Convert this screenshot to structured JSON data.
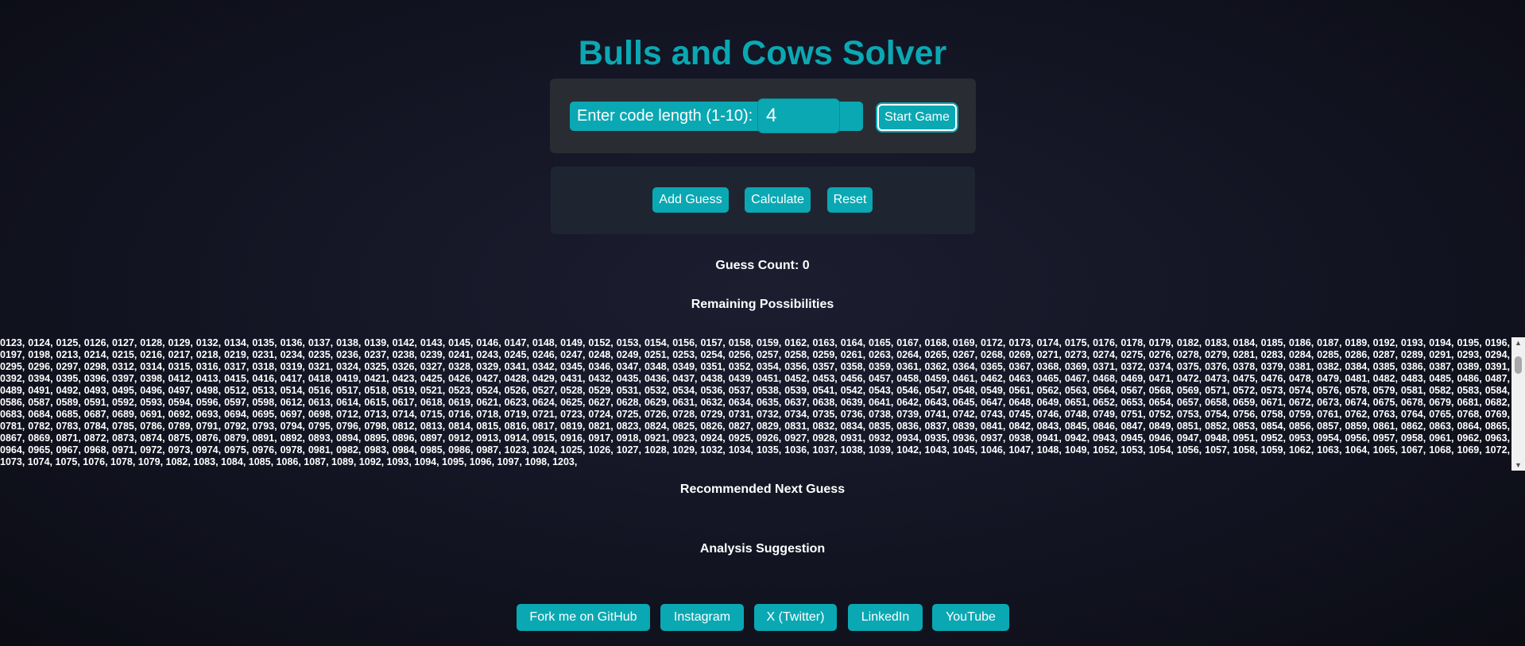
{
  "title": "Bulls and Cows Solver",
  "setup": {
    "length_label": "Enter code length (1-10):",
    "length_value": "4",
    "start_label": "Start Game"
  },
  "actions": {
    "add_guess": "Add Guess",
    "calculate": "Calculate",
    "reset": "Reset"
  },
  "guess_count": "Guess Count: 0",
  "remaining_heading": "Remaining Possibilities",
  "remaining_list": "0123, 0124, 0125, 0126, 0127, 0128, 0129, 0132, 0134, 0135, 0136, 0137, 0138, 0139, 0142, 0143, 0145, 0146, 0147, 0148, 0149, 0152, 0153, 0154, 0156, 0157, 0158, 0159, 0162, 0163, 0164, 0165, 0167, 0168, 0169, 0172, 0173, 0174, 0175, 0176, 0178, 0179, 0182, 0183, 0184, 0185, 0186, 0187, 0189, 0192, 0193, 0194, 0195, 0196, 0197, 0198, 0213, 0214, 0215, 0216, 0217, 0218, 0219, 0231, 0234, 0235, 0236, 0237, 0238, 0239, 0241, 0243, 0245, 0246, 0247, 0248, 0249, 0251, 0253, 0254, 0256, 0257, 0258, 0259, 0261, 0263, 0264, 0265, 0267, 0268, 0269, 0271, 0273, 0274, 0275, 0276, 0278, 0279, 0281, 0283, 0284, 0285, 0286, 0287, 0289, 0291, 0293, 0294, 0295, 0296, 0297, 0298, 0312, 0314, 0315, 0316, 0317, 0318, 0319, 0321, 0324, 0325, 0326, 0327, 0328, 0329, 0341, 0342, 0345, 0346, 0347, 0348, 0349, 0351, 0352, 0354, 0356, 0357, 0358, 0359, 0361, 0362, 0364, 0365, 0367, 0368, 0369, 0371, 0372, 0374, 0375, 0376, 0378, 0379, 0381, 0382, 0384, 0385, 0386, 0387, 0389, 0391, 0392, 0394, 0395, 0396, 0397, 0398, 0412, 0413, 0415, 0416, 0417, 0418, 0419, 0421, 0423, 0425, 0426, 0427, 0428, 0429, 0431, 0432, 0435, 0436, 0437, 0438, 0439, 0451, 0452, 0453, 0456, 0457, 0458, 0459, 0461, 0462, 0463, 0465, 0467, 0468, 0469, 0471, 0472, 0473, 0475, 0476, 0478, 0479, 0481, 0482, 0483, 0485, 0486, 0487, 0489, 0491, 0492, 0493, 0495, 0496, 0497, 0498, 0512, 0513, 0514, 0516, 0517, 0518, 0519, 0521, 0523, 0524, 0526, 0527, 0528, 0529, 0531, 0532, 0534, 0536, 0537, 0538, 0539, 0541, 0542, 0543, 0546, 0547, 0548, 0549, 0561, 0562, 0563, 0564, 0567, 0568, 0569, 0571, 0572, 0573, 0574, 0576, 0578, 0579, 0581, 0582, 0583, 0584, 0586, 0587, 0589, 0591, 0592, 0593, 0594, 0596, 0597, 0598, 0612, 0613, 0614, 0615, 0617, 0618, 0619, 0621, 0623, 0624, 0625, 0627, 0628, 0629, 0631, 0632, 0634, 0635, 0637, 0638, 0639, 0641, 0642, 0643, 0645, 0647, 0648, 0649, 0651, 0652, 0653, 0654, 0657, 0658, 0659, 0671, 0672, 0673, 0674, 0675, 0678, 0679, 0681, 0682, 0683, 0684, 0685, 0687, 0689, 0691, 0692, 0693, 0694, 0695, 0697, 0698, 0712, 0713, 0714, 0715, 0716, 0718, 0719, 0721, 0723, 0724, 0725, 0726, 0728, 0729, 0731, 0732, 0734, 0735, 0736, 0738, 0739, 0741, 0742, 0743, 0745, 0746, 0748, 0749, 0751, 0752, 0753, 0754, 0756, 0758, 0759, 0761, 0762, 0763, 0764, 0765, 0768, 0769, 0781, 0782, 0783, 0784, 0785, 0786, 0789, 0791, 0792, 0793, 0794, 0795, 0796, 0798, 0812, 0813, 0814, 0815, 0816, 0817, 0819, 0821, 0823, 0824, 0825, 0826, 0827, 0829, 0831, 0832, 0834, 0835, 0836, 0837, 0839, 0841, 0842, 0843, 0845, 0846, 0847, 0849, 0851, 0852, 0853, 0854, 0856, 0857, 0859, 0861, 0862, 0863, 0864, 0865, 0867, 0869, 0871, 0872, 0873, 0874, 0875, 0876, 0879, 0891, 0892, 0893, 0894, 0895, 0896, 0897, 0912, 0913, 0914, 0915, 0916, 0917, 0918, 0921, 0923, 0924, 0925, 0926, 0927, 0928, 0931, 0932, 0934, 0935, 0936, 0937, 0938, 0941, 0942, 0943, 0945, 0946, 0947, 0948, 0951, 0952, 0953, 0954, 0956, 0957, 0958, 0961, 0962, 0963, 0964, 0965, 0967, 0968, 0971, 0972, 0973, 0974, 0975, 0976, 0978, 0981, 0982, 0983, 0984, 0985, 0986, 0987, 1023, 1024, 1025, 1026, 1027, 1028, 1029, 1032, 1034, 1035, 1036, 1037, 1038, 1039, 1042, 1043, 1045, 1046, 1047, 1048, 1049, 1052, 1053, 1054, 1056, 1057, 1058, 1059, 1062, 1063, 1064, 1065, 1067, 1068, 1069, 1072, 1073, 1074, 1075, 1076, 1078, 1079, 1082, 1083, 1084, 1085, 1086, 1087, 1089, 1092, 1093, 1094, 1095, 1096, 1097, 1098, 1203,",
  "recommended_heading": "Recommended Next Guess",
  "analysis_heading": "Analysis Suggestion",
  "social": {
    "github": "Fork me on GitHub",
    "instagram": "Instagram",
    "twitter": "X (Twitter)",
    "linkedin": "LinkedIn",
    "youtube": "YouTube"
  },
  "colors": {
    "accent": "#0aa8b3",
    "panel_setup": "#2a2c33",
    "panel_actions": "#1f2530",
    "background": "#141625"
  }
}
